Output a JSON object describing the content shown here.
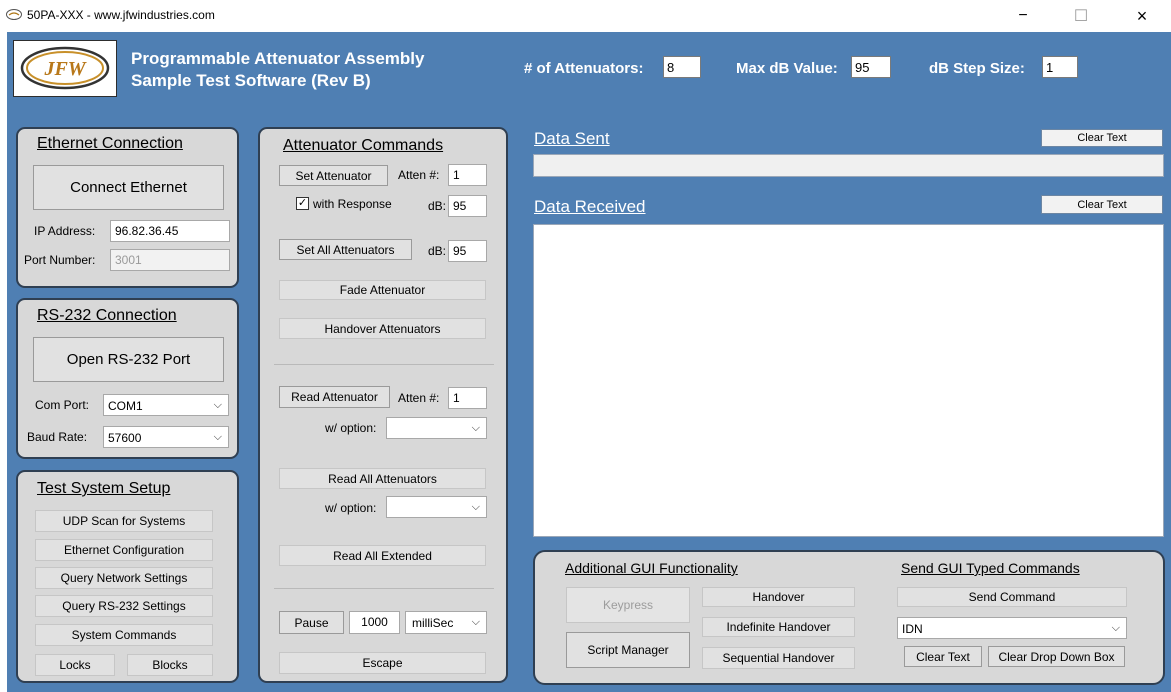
{
  "window": {
    "title": "50PA-XXX - www.jfwindustries.com",
    "minimize": "−",
    "maximize": "☐",
    "close": "×"
  },
  "header": {
    "logo_text": "JFW",
    "title_line1": "Programmable Attenuator Assembly",
    "title_line2": "Sample Test Software (Rev B)",
    "num_attenuators_label": "# of Attenuators:",
    "num_attenuators_value": "8",
    "max_db_label": "Max dB Value:",
    "max_db_value": "95",
    "db_step_label": "dB Step Size:",
    "db_step_value": "1"
  },
  "ethernet": {
    "title": "Ethernet Connection",
    "connect_button": "Connect Ethernet",
    "ip_label": "IP Address:",
    "ip_value": "96.82.36.45",
    "port_label": "Port Number:",
    "port_value": "3001"
  },
  "rs232": {
    "title": "RS-232 Connection",
    "open_button": "Open RS-232 Port",
    "com_label": "Com Port:",
    "com_value": "COM1",
    "baud_label": "Baud Rate:",
    "baud_value": "57600"
  },
  "test_setup": {
    "title": "Test System Setup",
    "buttons": [
      "UDP Scan for Systems",
      "Ethernet Configuration",
      "Query Network Settings",
      "Query RS-232 Settings",
      "System Commands"
    ],
    "locks": "Locks",
    "blocks": "Blocks"
  },
  "attenuator_commands": {
    "title": "Attenuator Commands",
    "set_attenuator": "Set Attenuator",
    "atten_num_label": "Atten #:",
    "atten_num_value": "1",
    "with_response": "with Response",
    "db_label": "dB:",
    "db_value": "95",
    "set_all": "Set All Attenuators",
    "set_all_db_label": "dB:",
    "set_all_db_value": "95",
    "fade": "Fade Attenuator",
    "handover": "Handover Attenuators",
    "read_attenuator": "Read Attenuator",
    "read_atten_label": "Atten #:",
    "read_atten_value": "1",
    "w_option": "w/ option:",
    "read_all": "Read All Attenuators",
    "w_option2": "w/ option:",
    "read_all_extended": "Read All Extended",
    "pause": "Pause",
    "pause_value": "1000",
    "pause_unit": "milliSec",
    "escape": "Escape"
  },
  "data": {
    "sent_title": "Data Sent",
    "received_title": "Data Received",
    "clear_text": "Clear Text",
    "clear_text2": "Clear Text"
  },
  "additional": {
    "title": "Additional GUI Functionality",
    "keypress": "Keypress",
    "script_manager": "Script Manager",
    "handover": "Handover",
    "indefinite_handover": "Indefinite Handover",
    "sequential_handover": "Sequential Handover"
  },
  "send_typed": {
    "title": "Send GUI Typed Commands",
    "send_command": "Send Command",
    "command_value": "IDN",
    "clear_text": "Clear Text",
    "clear_dropdown": "Clear Drop Down Box"
  },
  "colors": {
    "window_bg": "#4f7fb3",
    "panel_bg": "#d8d8d8",
    "panel_border": "#2f3f52"
  }
}
